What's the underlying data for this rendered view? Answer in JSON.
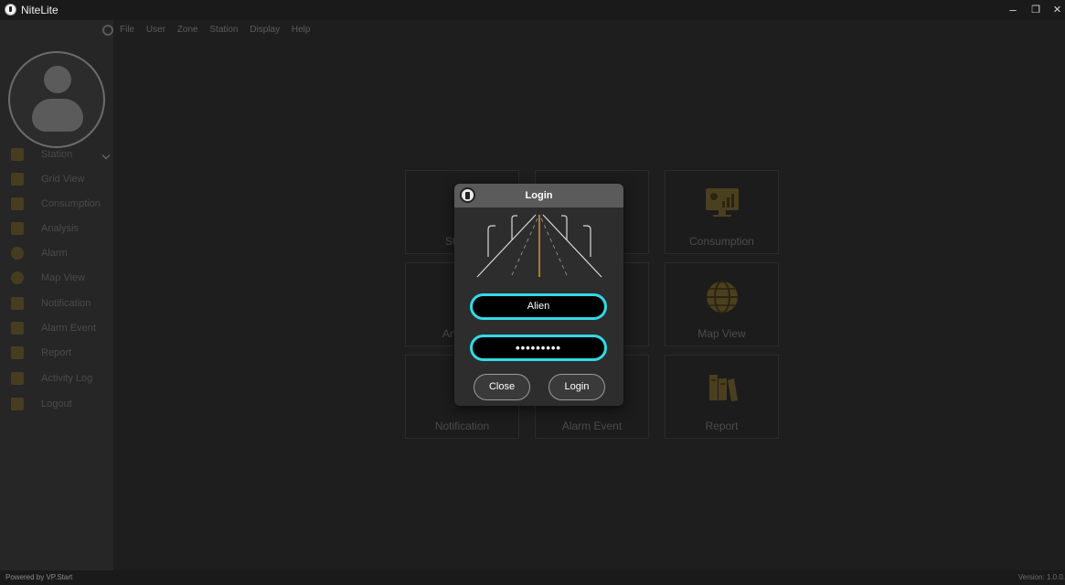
{
  "window": {
    "title": "NiteLite",
    "min_glyph": "–",
    "restore_glyph": "❐",
    "close_glyph": "✕"
  },
  "menubar": {
    "items": [
      "File",
      "User",
      "Zone",
      "Station",
      "Display",
      "Help"
    ]
  },
  "sidebar": {
    "items": [
      {
        "label": "Station",
        "icon": "station-icon"
      },
      {
        "label": "Grid View",
        "icon": "grid-view-icon"
      },
      {
        "label": "Consumption",
        "icon": "consumption-icon"
      },
      {
        "label": "Analysis",
        "icon": "analysis-icon"
      },
      {
        "label": "Alarm",
        "icon": "alarm-icon"
      },
      {
        "label": "Map View",
        "icon": "globe-icon"
      },
      {
        "label": "Notification",
        "icon": "notification-icon"
      },
      {
        "label": "Alarm Event",
        "icon": "alarm-event-icon"
      },
      {
        "label": "Report",
        "icon": "report-icon"
      },
      {
        "label": "Activity Log",
        "icon": "activity-log-icon"
      },
      {
        "label": "Logout",
        "icon": "logout-icon"
      }
    ]
  },
  "tiles": {
    "station": "St",
    "consumption": "Consumption",
    "analysis": "An",
    "map_view": "Map View",
    "notification": "Notification",
    "alarm_event": "Alarm Event",
    "report": "Report"
  },
  "login": {
    "title": "Login",
    "username": "Alien",
    "password_mask": "•••••••••",
    "close_label": "Close",
    "login_label": "Login"
  },
  "status": {
    "powered": "Powered by VP.Start",
    "version": "Version: 1.0.0."
  },
  "colors": {
    "accent_cyan": "#33d9e6",
    "icon_gold": "#b9972c",
    "background": "#1e1e1e"
  }
}
